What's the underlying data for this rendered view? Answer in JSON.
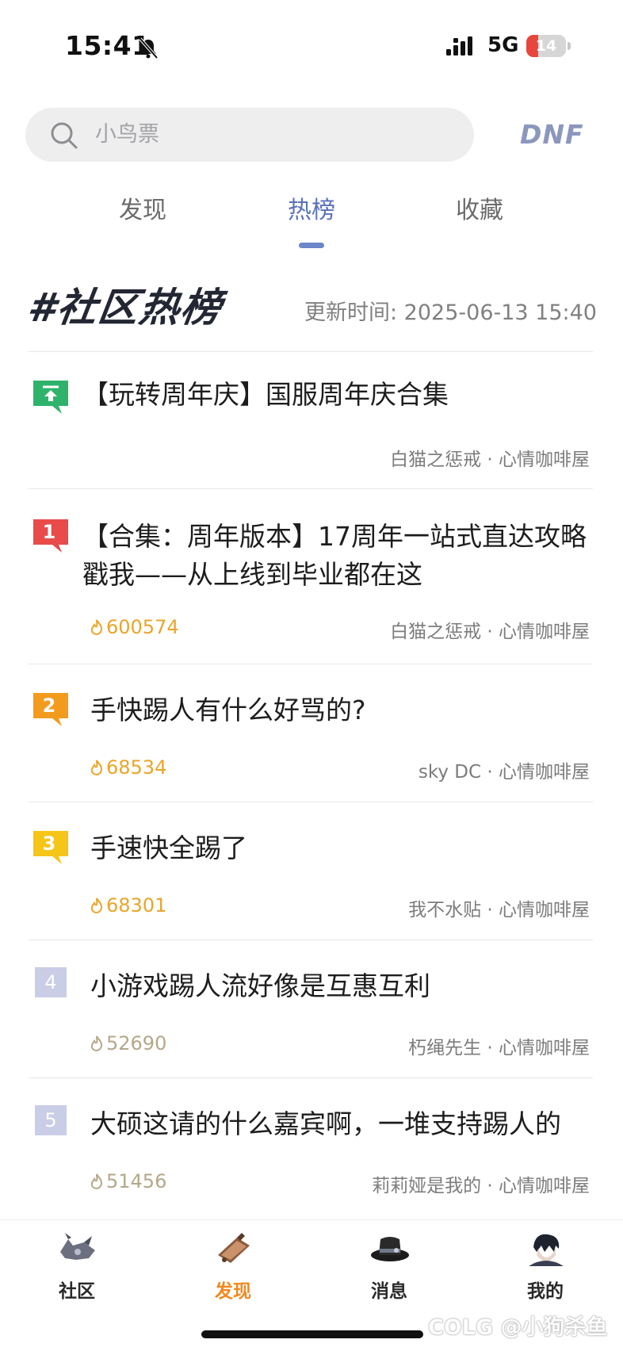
{
  "status_bar": {
    "time": "15:41",
    "network": "5G",
    "battery_level": "14",
    "battery_fraction": 0.14
  },
  "search": {
    "placeholder": "小鸟票",
    "game_label": "DNF"
  },
  "tabs": [
    {
      "label": "发现",
      "active": false
    },
    {
      "label": "热榜",
      "active": true
    },
    {
      "label": "收藏",
      "active": false
    }
  ],
  "section": {
    "title": "#社区热榜",
    "update_time": "更新时间: 2025-06-13 15:40"
  },
  "hot_list": [
    {
      "rank": "",
      "badge": "pinned",
      "title": "【玩转周年庆】国服周年庆合集",
      "heat": "",
      "author": "白猫之惩戒 · 心情咖啡屋"
    },
    {
      "rank": "1",
      "badge": "red",
      "title": "【合集：周年版本】17周年一站式直达攻略戳我——从上线到毕业都在这",
      "heat": "600574",
      "author": "白猫之惩戒 · 心情咖啡屋"
    },
    {
      "rank": "2",
      "badge": "orange",
      "title": "手快踢人有什么好骂的?",
      "heat": "68534",
      "author": "sky DC · 心情咖啡屋"
    },
    {
      "rank": "3",
      "badge": "yellow",
      "title": "手速快全踢了",
      "heat": "68301",
      "author": "我不水贴 · 心情咖啡屋"
    },
    {
      "rank": "4",
      "badge": "plain",
      "title": "小游戏踢人流好像是互惠互利",
      "heat": "52690",
      "author": "朽绳先生 · 心情咖啡屋"
    },
    {
      "rank": "5",
      "badge": "plain",
      "title": "大硕这请的什么嘉宾啊，一堆支持踢人的",
      "heat": "51456",
      "author": "莉莉娅是我的 · 心情咖啡屋"
    }
  ],
  "bottom_nav": [
    {
      "label": "社区",
      "icon": "community-icon",
      "active": false
    },
    {
      "label": "发现",
      "icon": "discover-icon",
      "active": true
    },
    {
      "label": "消息",
      "icon": "message-icon",
      "active": false
    },
    {
      "label": "我的",
      "icon": "profile-icon",
      "active": false
    }
  ],
  "watermark": "COLG @小狗杀鱼",
  "colors": {
    "accent_blue": "#5a72b8",
    "accent_orange": "#f08a1f",
    "rank1": "#e94a4a",
    "rank2": "#f29b1d",
    "rank3": "#f5c518",
    "pinned": "#2fb36b"
  }
}
